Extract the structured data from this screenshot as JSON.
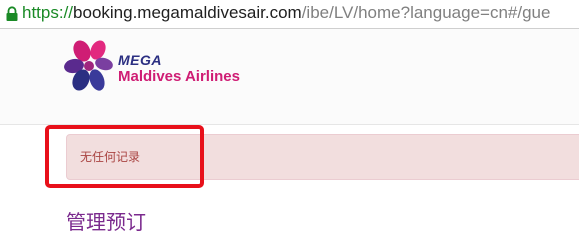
{
  "browser": {
    "url_scheme": "https://",
    "url_host": "booking.megamaldivesair.com",
    "url_path": "/ibe/LV/home?language=cn#/gue",
    "lock_icon": "lock-icon"
  },
  "header": {
    "logo_line1": "MEGA",
    "logo_line2": "Maldives Airlines",
    "brand_colors": {
      "navy": "#2b2f82",
      "magenta": "#cf1d74",
      "purple": "#7b2a8e"
    }
  },
  "alert": {
    "message": "无任何记录",
    "color": "#a94442",
    "background": "#f2dede"
  },
  "main": {
    "title": "管理预订"
  }
}
